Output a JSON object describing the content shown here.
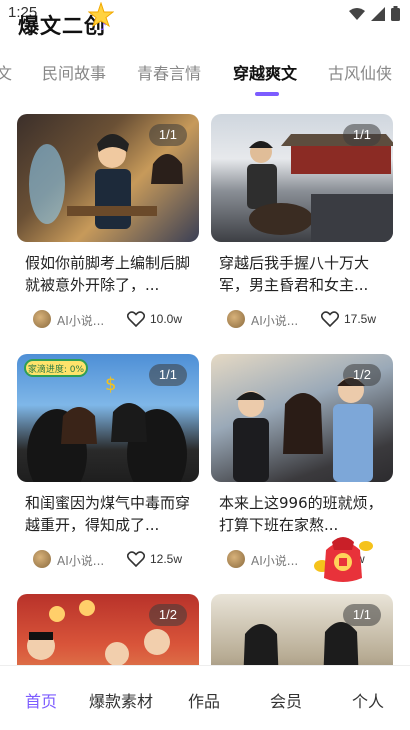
{
  "status_bar": {
    "time": "1:25"
  },
  "app": {
    "title": "爆文二创",
    "sparkle": "♪"
  },
  "tabs": [
    {
      "label": "文"
    },
    {
      "label": "民间故事"
    },
    {
      "label": "青春言情"
    },
    {
      "label": "穿越爽文",
      "active": true
    },
    {
      "label": "古风仙侠"
    }
  ],
  "cards": [
    {
      "badge": "1/1",
      "title": "假如你前脚考上编制后脚就被意外开除了，...",
      "author": "AI小说...",
      "likes": "10.0w"
    },
    {
      "badge": "1/1",
      "title": "穿越后我手握八十万大军，男主昏君和女主...",
      "author": "AI小说...",
      "likes": "17.5w"
    },
    {
      "badge": "1/1",
      "title": "和闺蜜因为煤气中毒而穿越重开，得知成了...",
      "author": "AI小说...",
      "likes": "12.5w",
      "sticker": "家滴进度: 0%"
    },
    {
      "badge": "1/2",
      "title": "本来上这996的班就烦，打算下班在家熬...",
      "author": "AI小说...",
      "likes": "w"
    },
    {
      "badge": "1/2"
    },
    {
      "badge": "1/1"
    }
  ],
  "bottom_nav": [
    {
      "label": "首页",
      "active": true
    },
    {
      "label": "爆款素材"
    },
    {
      "label": "作品"
    },
    {
      "label": "会员"
    },
    {
      "label": "个人"
    }
  ],
  "colors": {
    "accent": "#7c5cff",
    "red_envelope": "#e8323a"
  }
}
